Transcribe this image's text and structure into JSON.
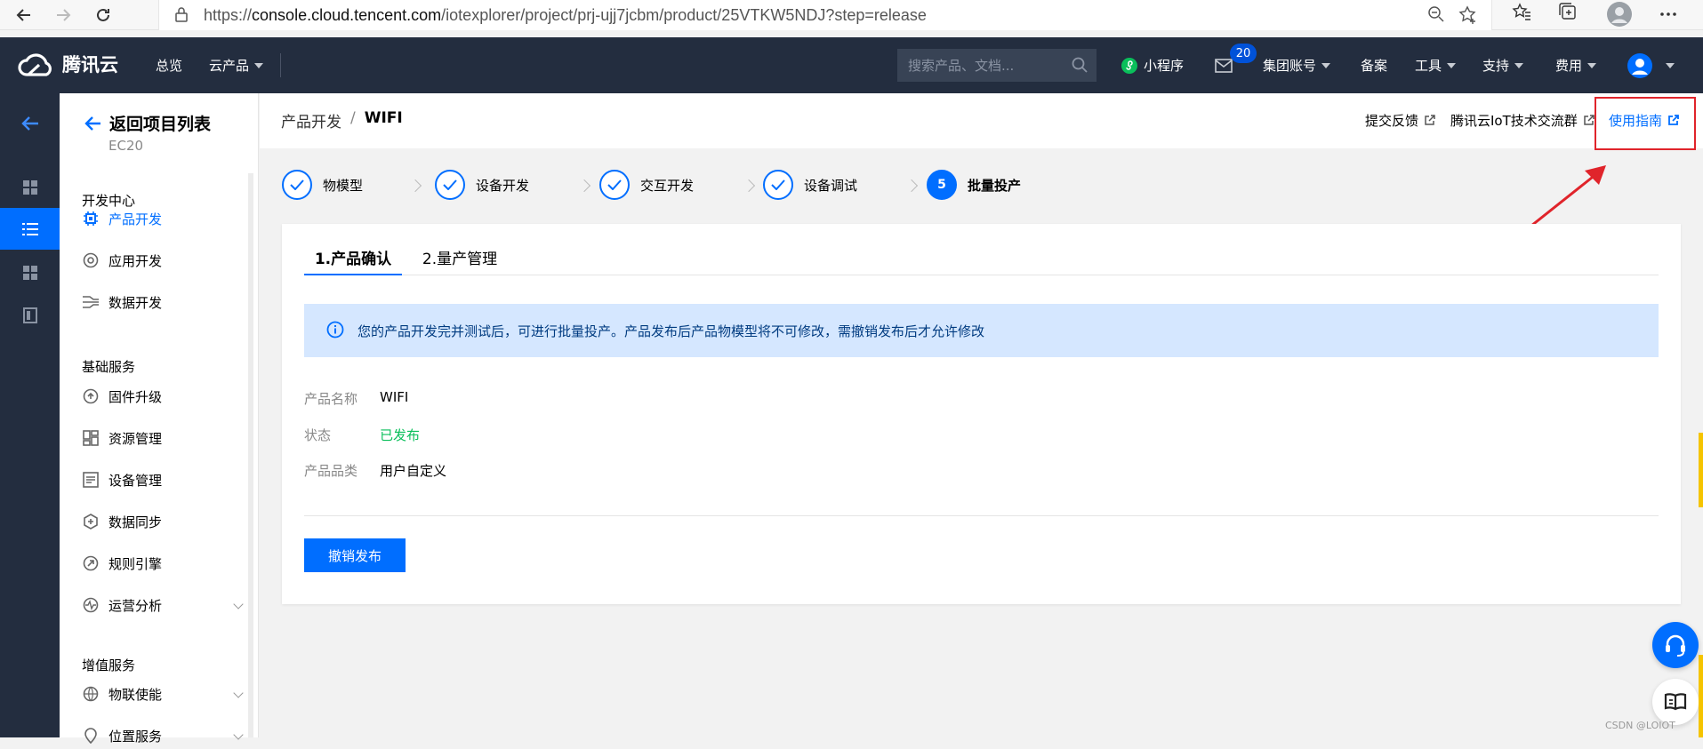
{
  "browser": {
    "url_prefix": "https://",
    "url_host": "console.cloud.tencent.com",
    "url_path": "/iotexplorer/project/prj-ujj7jcbm/product/25VTKW5NDJ?step=release"
  },
  "topnav": {
    "logo_text": "腾讯云",
    "overview": "总览",
    "products": "云产品",
    "search_placeholder": "搜索产品、文档...",
    "mini_program": "小程序",
    "message_count": "20",
    "group_account": "集团账号",
    "record": "备案",
    "tools": "工具",
    "support": "支持",
    "fees": "费用"
  },
  "sidebar": {
    "back_label": "返回项目列表",
    "project_code": "EC20",
    "sections": [
      {
        "title": "开发中心"
      },
      {
        "title": "基础服务"
      },
      {
        "title": "增值服务"
      }
    ],
    "items": [
      {
        "label": "产品开发"
      },
      {
        "label": "应用开发"
      },
      {
        "label": "数据开发"
      },
      {
        "label": "固件升级"
      },
      {
        "label": "资源管理"
      },
      {
        "label": "设备管理"
      },
      {
        "label": "数据同步"
      },
      {
        "label": "规则引擎"
      },
      {
        "label": "运营分析"
      },
      {
        "label": "物联使能"
      },
      {
        "label": "位置服务"
      }
    ]
  },
  "header": {
    "breadcrumb_parent": "产品开发",
    "breadcrumb_sep": "/",
    "breadcrumb_current": "WIFI",
    "feedback": "提交反馈",
    "community": "腾讯云IoT技术交流群",
    "guide": "使用指南"
  },
  "steps": [
    {
      "label": "物模型",
      "state": "done"
    },
    {
      "label": "设备开发",
      "state": "done"
    },
    {
      "label": "交互开发",
      "state": "done"
    },
    {
      "label": "设备调试",
      "state": "done"
    },
    {
      "label": "批量投产",
      "state": "current",
      "number": "5"
    }
  ],
  "tabs": [
    {
      "label": "1.产品确认",
      "active": true
    },
    {
      "label": "2.量产管理",
      "active": false
    }
  ],
  "notice": "您的产品开发完并测试后，可进行批量投产。产品发布后产品物模型将不可修改，需撤销发布后才允许修改",
  "fields": [
    {
      "label": "产品名称",
      "value": "WIFI"
    },
    {
      "label": "状态",
      "value": "已发布"
    },
    {
      "label": "产品品类",
      "value": "用户自定义"
    }
  ],
  "actions": {
    "revoke_publish": "撤销发布"
  },
  "watermark": "CSDN @LOIOT",
  "colors": {
    "primary": "#006eff",
    "nav_bg": "#232d3f",
    "success": "#0abf5b",
    "highlight_box": "#e0242b"
  }
}
